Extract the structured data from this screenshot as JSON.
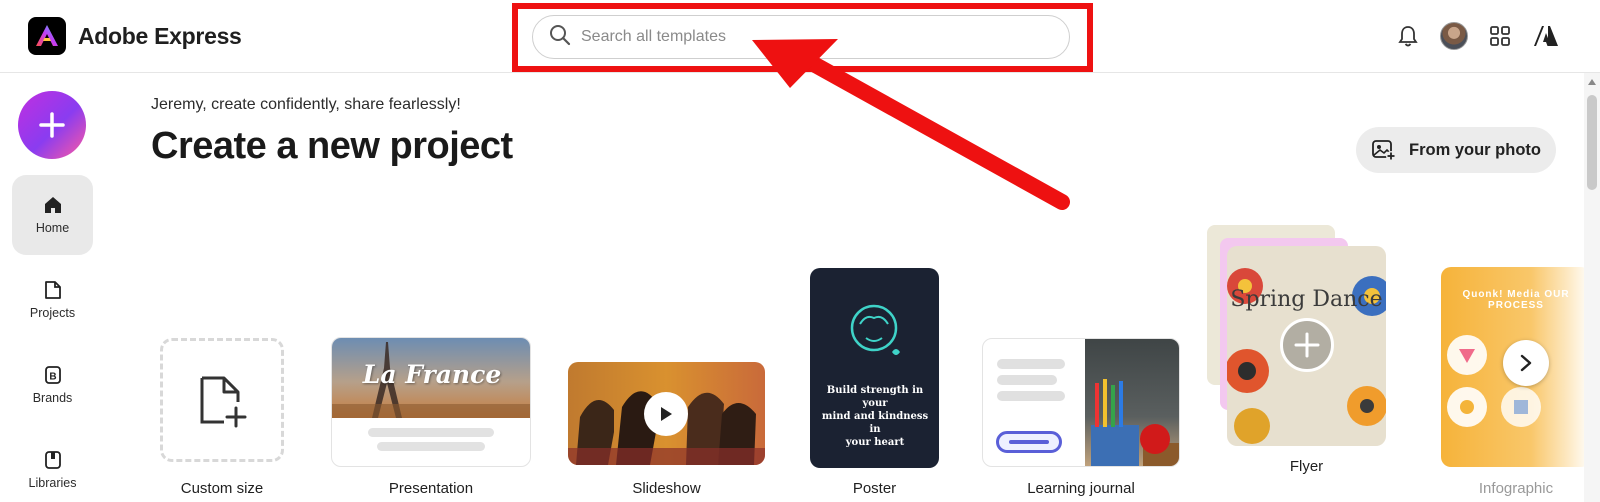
{
  "header": {
    "app_name": "Adobe Express",
    "search_placeholder": "Search all templates"
  },
  "sidebar": {
    "create_label": "+",
    "items": [
      {
        "label": "Home",
        "active": true
      },
      {
        "label": "Projects",
        "active": false
      },
      {
        "label": "Brands",
        "active": false
      },
      {
        "label": "Libraries",
        "active": false
      }
    ]
  },
  "main": {
    "greeting": "Jeremy, create confidently, share fearlessly!",
    "title": "Create a new project",
    "from_photo_label": "From your photo",
    "cards": [
      {
        "label": "Custom size"
      },
      {
        "label": "Presentation",
        "thumb_text": "La France"
      },
      {
        "label": "Slideshow"
      },
      {
        "label": "Poster",
        "thumb_text_1": "Build strength in your",
        "thumb_text_2": "mind and kindness in",
        "thumb_text_3": "your heart"
      },
      {
        "label": "Learning journal"
      },
      {
        "label": "Flyer",
        "thumb_text": "Spring Dance"
      },
      {
        "label": "Infographic",
        "thumb_text": "Quonk! Media OUR PROCESS"
      }
    ]
  },
  "annotation": {
    "highlight_color": "#ee1111"
  },
  "colors": {
    "accent_gradient_start": "#c12fe0",
    "accent_gradient_end": "#ff5aa0",
    "nav_active_bg": "#e9e9e9"
  }
}
